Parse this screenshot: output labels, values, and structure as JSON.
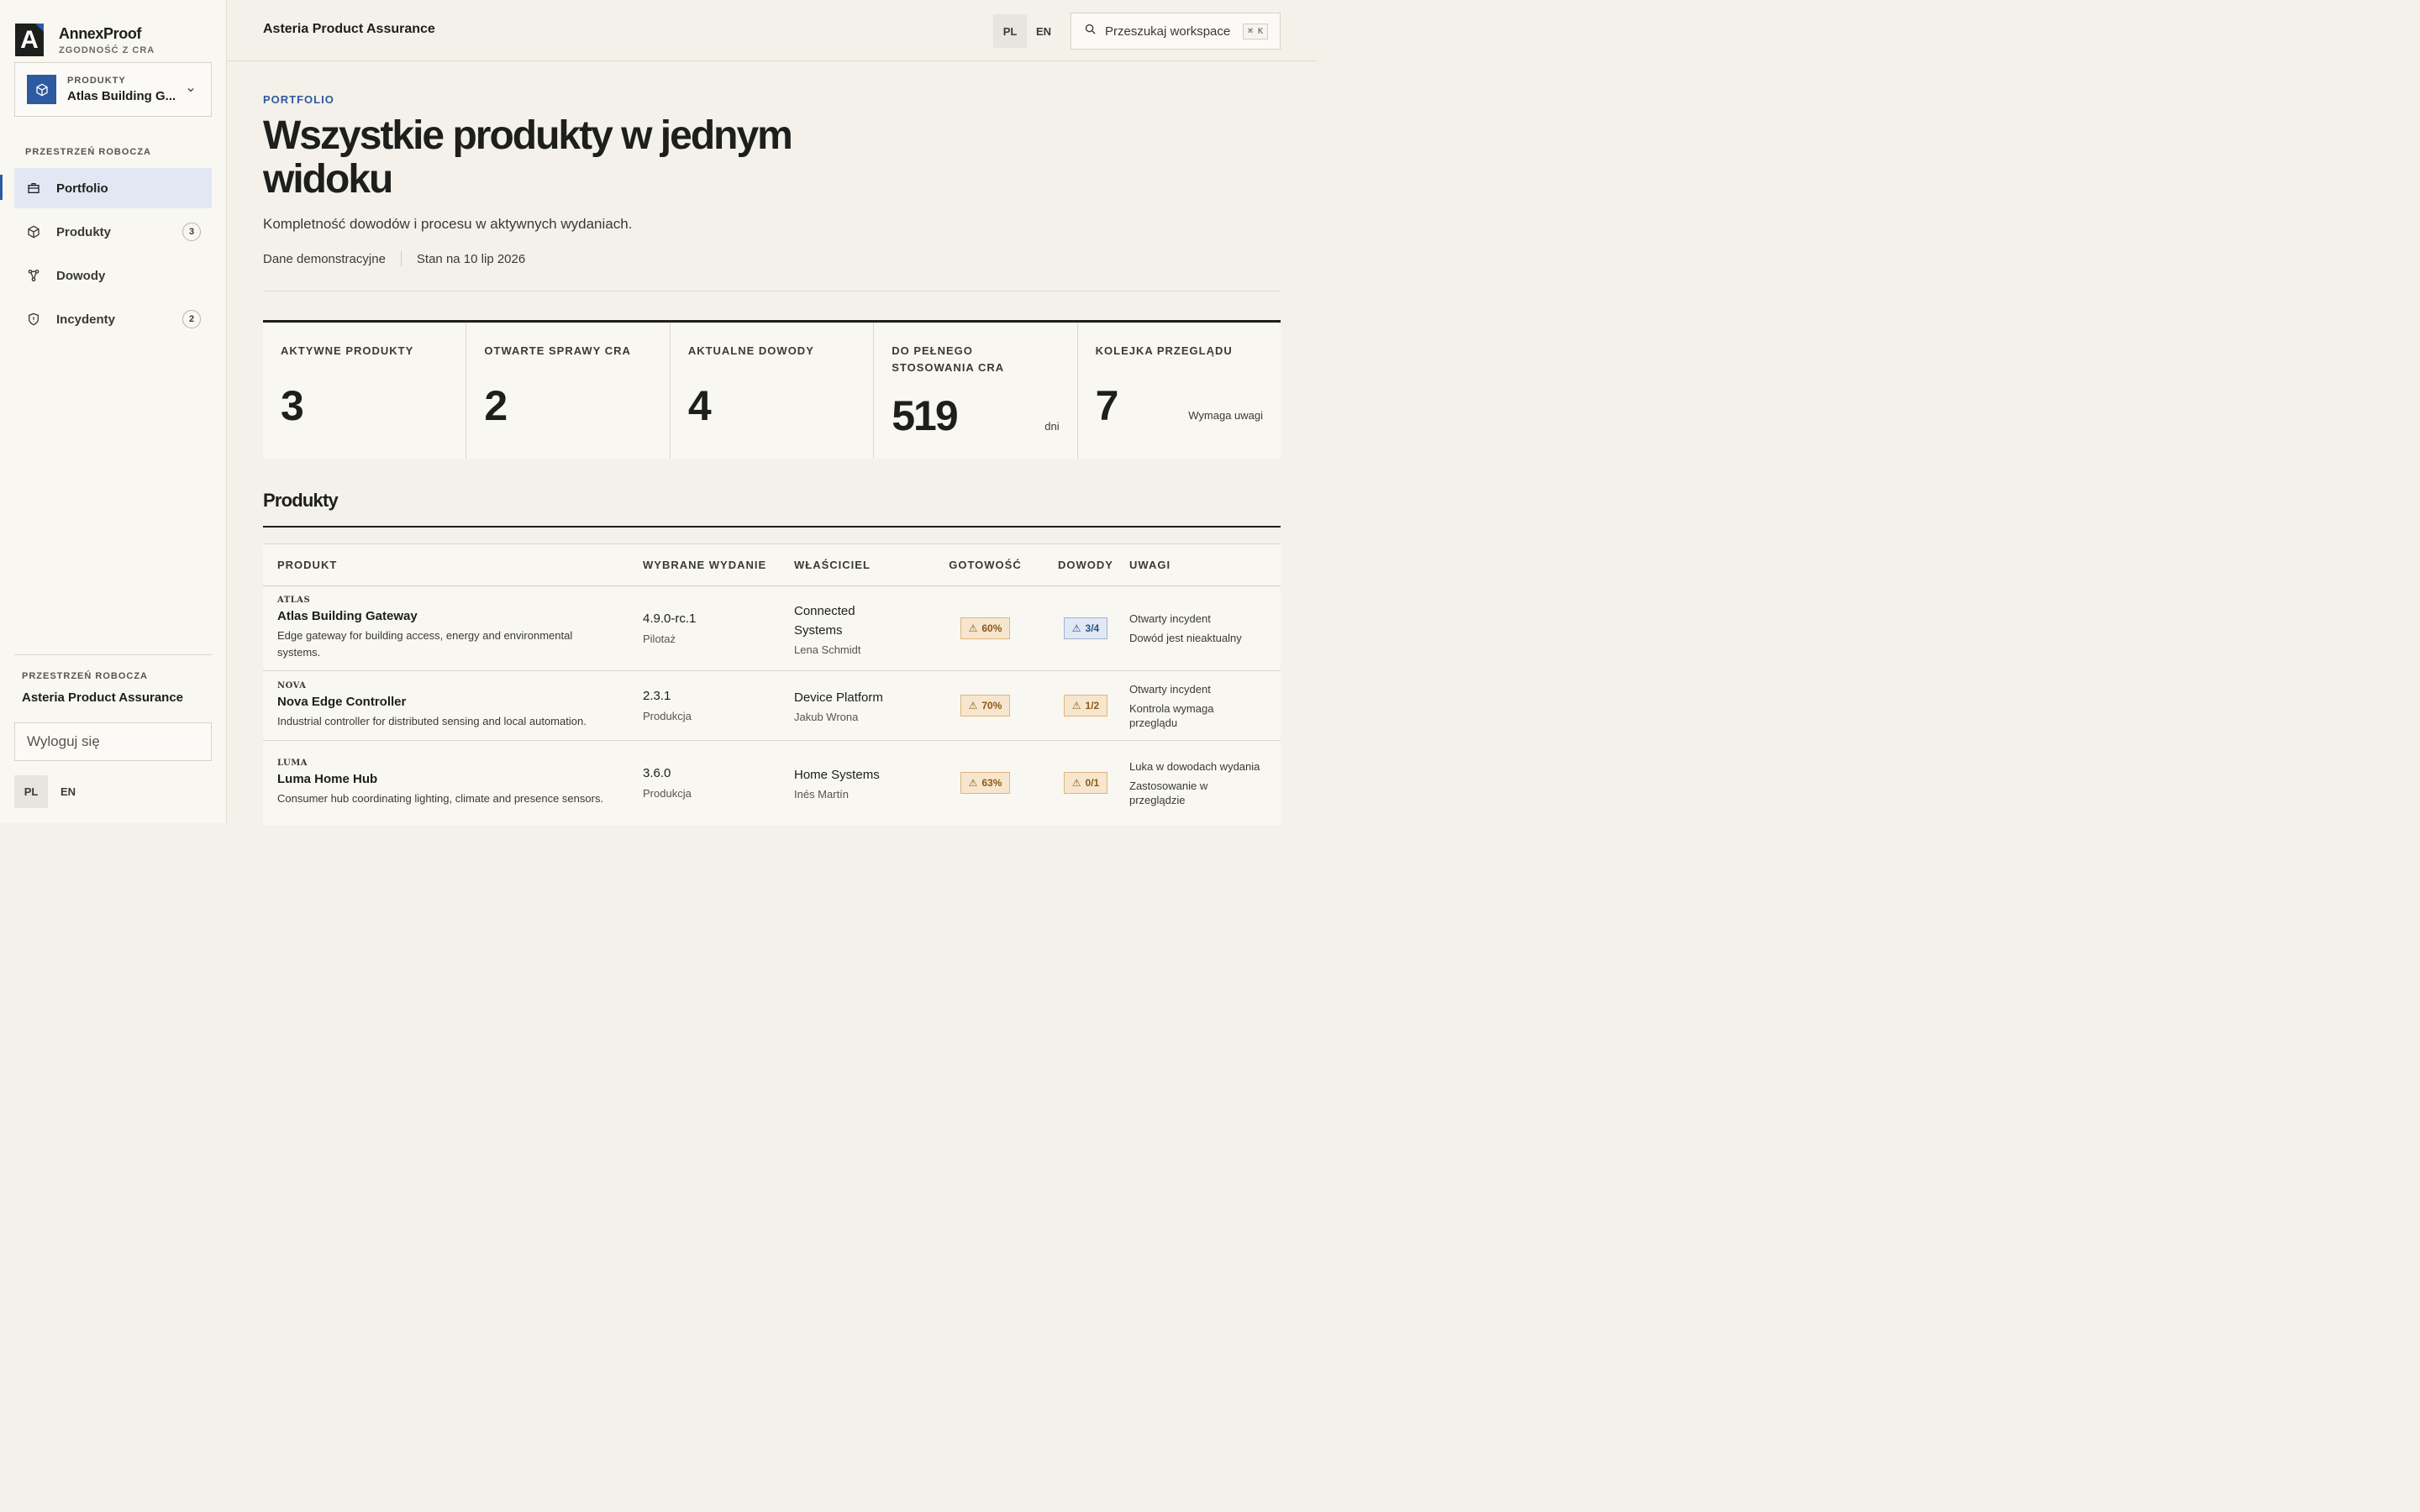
{
  "brand": {
    "name": "AnnexProof",
    "subtitle": "ZGODNOŚĆ Z CRA",
    "logo_letter": "A"
  },
  "product_switcher": {
    "kicker": "PRODUKTY",
    "selected": "Atlas Building G...",
    "icon": "cube-icon"
  },
  "sidebar": {
    "section_label": "PRZESTRZEŃ ROBOCZA",
    "items": [
      {
        "label": "Portfolio",
        "icon": "briefcase-icon",
        "active": true,
        "badge": ""
      },
      {
        "label": "Produkty",
        "icon": "cube-icon",
        "active": false,
        "badge": "3"
      },
      {
        "label": "Dowody",
        "icon": "nodes-icon",
        "active": false,
        "badge": ""
      },
      {
        "label": "Incydenty",
        "icon": "shield-alert-icon",
        "active": false,
        "badge": "2"
      }
    ],
    "workspace_label": "PRZESTRZEŃ ROBOCZA",
    "workspace_name": "Asteria Product Assurance",
    "logout": "Wyloguj się",
    "lang": {
      "pl": "PL",
      "en": "EN",
      "active": "PL"
    }
  },
  "topbar": {
    "title": "Asteria Product Assurance",
    "lang": {
      "pl": "PL",
      "en": "EN",
      "active": "PL"
    },
    "search_placeholder": "Przeszukaj workspace",
    "shortcut": "⌘ K"
  },
  "page": {
    "kicker": "PORTFOLIO",
    "title": "Wszystkie produkty w jednym widoku",
    "subtitle": "Kompletność dowodów i procesu w aktywnych wydaniach.",
    "meta_left": "Dane demonstracyjne",
    "meta_right": "Stan na 10 lip 2026"
  },
  "stats": [
    {
      "label": "AKTYWNE PRODUKTY",
      "value": "3",
      "note": ""
    },
    {
      "label": "OTWARTE SPRAWY CRA",
      "value": "2",
      "note": ""
    },
    {
      "label": "AKTUALNE DOWODY",
      "value": "4",
      "note": ""
    },
    {
      "label": "DO PEŁNEGO STOSOWANIA CRA",
      "value": "519",
      "note": "dni"
    },
    {
      "label": "KOLEJKA PRZEGLĄDU",
      "value": "7",
      "note": "Wymaga uwagi"
    }
  ],
  "products": {
    "heading": "Produkty",
    "columns": [
      "PRODUKT",
      "WYBRANE WYDANIE",
      "WŁAŚCICIEL",
      "GOTOWOŚĆ",
      "DOWODY",
      "UWAGI"
    ],
    "rows": [
      {
        "code": "ATLAS",
        "name": "Atlas Building Gateway",
        "desc": "Edge gateway for building access, energy and environmental systems.",
        "version": "4.9.0-rc.1",
        "stage": "Pilotaż",
        "owner": "Connected Systems",
        "person": "Lena Schmidt",
        "readiness": "60%",
        "evidence": "3/4",
        "evidence_style": "info",
        "notes": [
          "Otwarty incydent",
          "Dowód jest nieaktualny"
        ]
      },
      {
        "code": "NOVA",
        "name": "Nova Edge Controller",
        "desc": "Industrial controller for distributed sensing and local automation.",
        "version": "2.3.1",
        "stage": "Produkcja",
        "owner": "Device Platform",
        "person": "Jakub Wrona",
        "readiness": "70%",
        "evidence": "1/2",
        "evidence_style": "warn",
        "notes": [
          "Otwarty incydent",
          "Kontrola wymaga przeglądu"
        ]
      },
      {
        "code": "LUMA",
        "name": "Luma Home Hub",
        "desc": "Consumer hub coordinating lighting, climate and presence sensors.",
        "version": "3.6.0",
        "stage": "Produkcja",
        "owner": "Home Systems",
        "person": "Inés Martín",
        "readiness": "63%",
        "evidence": "0/1",
        "evidence_style": "warn",
        "notes": [
          "Luka w dowodach wydania",
          "Zastosowanie w przeglądzie"
        ]
      }
    ]
  },
  "colors": {
    "accent": "#2d5aa0",
    "warning_bg": "#f7e6cf",
    "info_bg": "#e2e8f3",
    "ink": "#1d1f1c"
  }
}
